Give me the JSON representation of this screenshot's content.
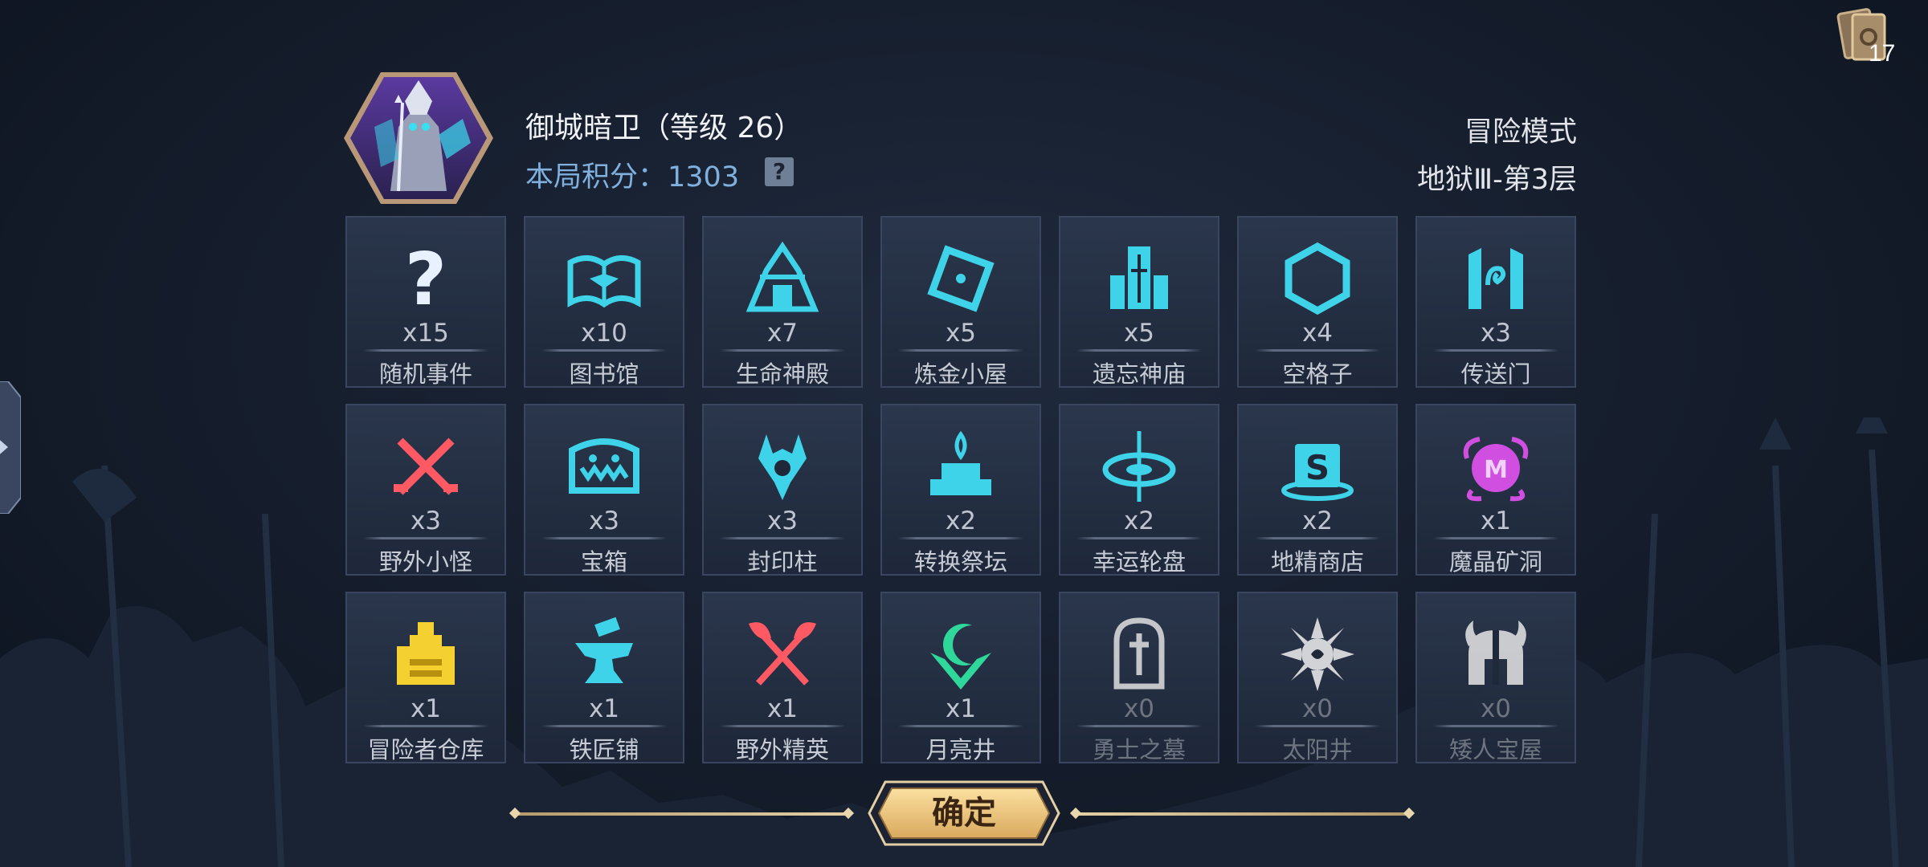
{
  "header": {
    "hero_name": "御城暗卫（等级 26）",
    "score_label": "本局积分：",
    "score_value": "1303",
    "help_label": "?",
    "mode": "冒险模式",
    "level": "地狱Ⅲ-第3层"
  },
  "deck": {
    "count": "17",
    "icon": "card-deck-icon"
  },
  "grid": [
    {
      "count": "x15",
      "label": "随机事件",
      "icon": "question-icon",
      "color": "#e8f1ff",
      "dim": false
    },
    {
      "count": "x10",
      "label": "图书馆",
      "icon": "book-icon",
      "color": "#3ed3e8",
      "dim": false
    },
    {
      "count": "x7",
      "label": "生命神殿",
      "icon": "temple-icon",
      "color": "#3ed3e8",
      "dim": false
    },
    {
      "count": "x5",
      "label": "炼金小屋",
      "icon": "alchemy-icon",
      "color": "#3ed3e8",
      "dim": false
    },
    {
      "count": "x5",
      "label": "遗忘神庙",
      "icon": "shrine-icon",
      "color": "#3ed3e8",
      "dim": false
    },
    {
      "count": "x4",
      "label": "空格子",
      "icon": "hexagon-icon",
      "color": "#3ed3e8",
      "dim": false
    },
    {
      "count": "x3",
      "label": "传送门",
      "icon": "portal-icon",
      "color": "#3ed3e8",
      "dim": false
    },
    {
      "count": "x3",
      "label": "野外小怪",
      "icon": "crossed-swords-icon",
      "color": "#ff5a64",
      "dim": false
    },
    {
      "count": "x3",
      "label": "宝箱",
      "icon": "treasure-chest-icon",
      "color": "#3ed3e8",
      "dim": false
    },
    {
      "count": "x3",
      "label": "封印柱",
      "icon": "seal-pillar-icon",
      "color": "#3ed3e8",
      "dim": false
    },
    {
      "count": "x2",
      "label": "转换祭坛",
      "icon": "altar-icon",
      "color": "#3ed3e8",
      "dim": false
    },
    {
      "count": "x2",
      "label": "幸运轮盘",
      "icon": "wheel-icon",
      "color": "#3ed3e8",
      "dim": false
    },
    {
      "count": "x2",
      "label": "地精商店",
      "icon": "goblin-shop-icon",
      "color": "#3ed3e8",
      "dim": false
    },
    {
      "count": "x1",
      "label": "魔晶矿洞",
      "icon": "crystal-mine-icon",
      "color": "#d04fe0",
      "dim": false
    },
    {
      "count": "x1",
      "label": "冒险者仓库",
      "icon": "warehouse-icon",
      "color": "#f4d030",
      "dim": false
    },
    {
      "count": "x1",
      "label": "铁匠铺",
      "icon": "anvil-icon",
      "color": "#3ed3e8",
      "dim": false
    },
    {
      "count": "x1",
      "label": "野外精英",
      "icon": "crossed-axes-icon",
      "color": "#ff5a64",
      "dim": false
    },
    {
      "count": "x1",
      "label": "月亮井",
      "icon": "moon-well-icon",
      "color": "#2fd89a",
      "dim": false
    },
    {
      "count": "x0",
      "label": "勇士之墓",
      "icon": "tombstone-icon",
      "color": "#e0e0e0",
      "dim": true
    },
    {
      "count": "x0",
      "label": "太阳井",
      "icon": "sun-icon",
      "color": "#f0f0f0",
      "dim": true
    },
    {
      "count": "x0",
      "label": "矮人宝屋",
      "icon": "dwarf-helmet-icon",
      "color": "#e6e6e6",
      "dim": true
    }
  ],
  "confirm": {
    "label": "确定"
  }
}
